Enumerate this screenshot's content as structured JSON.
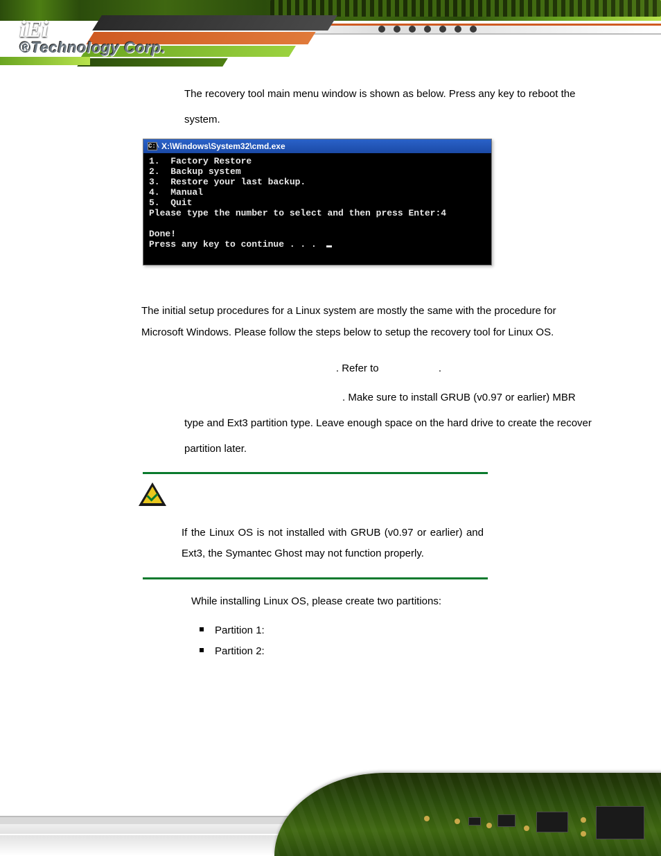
{
  "logo": {
    "brand": "iEi",
    "subtitle": "®Technology Corp."
  },
  "step6_intro": "The recovery tool main menu window is shown as below. Press any key to reboot the system.",
  "terminal": {
    "title_path": "X:\\Windows\\System32\\cmd.exe",
    "lines": "1.  Factory Restore\n2.  Backup system\n3.  Restore your last backup.\n4.  Manual\n5.  Quit\nPlease type the number to select and then press Enter:4\n\nDone!\nPress any key to continue . . . "
  },
  "linux_intro": "The initial setup procedures for a Linux system are mostly the same with the procedure for Microsoft Windows. Please follow the steps below to setup the recovery tool for Linux OS.",
  "linux_step1": {
    "refer": ". Refer to ",
    "dot": "."
  },
  "linux_step2": {
    "tail": ". Make sure to install GRUB (v0.97 or earlier) MBR type and Ext3 partition type. Leave enough space on the hard drive to create the recover partition later."
  },
  "note_text": "If the Linux OS is not installed with GRUB (v0.97 or earlier) and Ext3, the Symantec Ghost may not function properly.",
  "partitions_intro": "While installing Linux OS, please create two partitions:",
  "partitions": {
    "p1": "Partition 1:",
    "p2": "Partition 2:"
  }
}
